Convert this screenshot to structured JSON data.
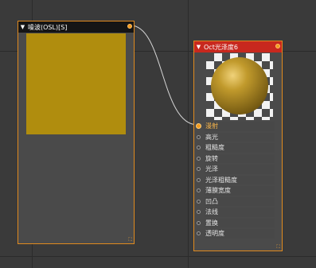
{
  "canvas": {
    "background_color": "#3a3a3a",
    "grid_color": "#2b2b2b"
  },
  "noise_node": {
    "title": "噪波(OSL)[S]",
    "collapse_icon": "triangle-down",
    "swatch_color": "#b08d0e",
    "border_color": "#e08a1e",
    "header_color": "#151515"
  },
  "material_node": {
    "title": "Oct光泽度6",
    "collapse_icon": "triangle-down",
    "header_color": "#c8281e",
    "preview_sphere_color": "#c19a2c",
    "params": [
      {
        "label": "漫射",
        "connected": true
      },
      {
        "label": "高光",
        "connected": false
      },
      {
        "label": "粗糙度",
        "connected": false
      },
      {
        "label": "旋转",
        "connected": false
      },
      {
        "label": "光泽",
        "connected": false
      },
      {
        "label": "光泽粗糙度",
        "connected": false
      },
      {
        "label": "薄膜宽度",
        "connected": false
      },
      {
        "label": "凹凸",
        "connected": false
      },
      {
        "label": "法线",
        "connected": false
      },
      {
        "label": "置换",
        "connected": false
      },
      {
        "label": "透明度",
        "connected": false
      }
    ]
  }
}
